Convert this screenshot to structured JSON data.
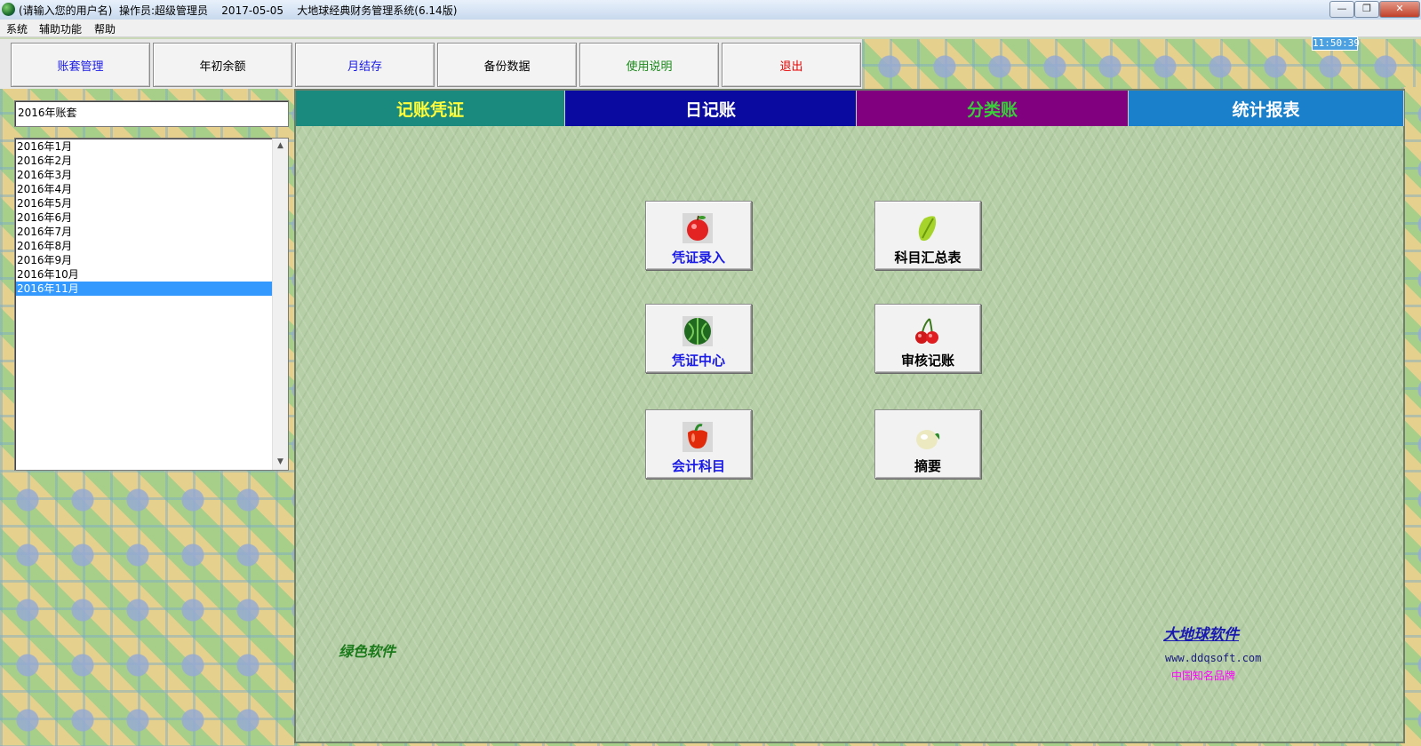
{
  "window": {
    "title": "(请输入您的用户名)  操作员:超级管理员    2017-05-05    大地球经典财务管理系统(6.14版)",
    "min_glyph": "—",
    "max_glyph": "❐",
    "close_glyph": "✕"
  },
  "menu": [
    "系统",
    "辅助功能",
    "帮助"
  ],
  "clock": "11:50:39",
  "toolbar": [
    {
      "label": "账套管理",
      "color": "#1a1ae6"
    },
    {
      "label": "年初余额",
      "color": "#000000"
    },
    {
      "label": "月结存",
      "color": "#1a1ae6"
    },
    {
      "label": "备份数据",
      "color": "#000000"
    },
    {
      "label": "使用说明",
      "color": "#1a8a1a"
    },
    {
      "label": "退出",
      "color": "#e60000"
    }
  ],
  "account_set": "2016年账套",
  "periods": [
    "2016年1月",
    "2016年2月",
    "2016年3月",
    "2016年4月",
    "2016年5月",
    "2016年6月",
    "2016年7月",
    "2016年8月",
    "2016年9月",
    "2016年10月",
    "2016年11月"
  ],
  "selected_period": "2016年11月",
  "tabs": [
    {
      "label": "记账凭证",
      "bg": "#1a8a7f",
      "fg": "#ffff3a"
    },
    {
      "label": "日记账",
      "bg": "#0a0aa0",
      "fg": "#ffffff"
    },
    {
      "label": "分类账",
      "bg": "#800080",
      "fg": "#3acc3a"
    },
    {
      "label": "统计报表",
      "bg": "#1a80cc",
      "fg": "#ffffff"
    }
  ],
  "functions": [
    {
      "label": "凭证录入",
      "icon": "apple-icon",
      "color": "#1a1ae6"
    },
    {
      "label": "凭证中心",
      "icon": "watermelon-icon",
      "color": "#1a1ae6"
    },
    {
      "label": "会计科目",
      "icon": "pepper-icon",
      "color": "#1a1ae6"
    },
    {
      "label": "科目汇总表",
      "icon": "starfruit-icon",
      "color": "#000000"
    },
    {
      "label": "审核记账",
      "icon": "cherry-icon",
      "color": "#000000"
    },
    {
      "label": "摘要",
      "icon": "melon-icon",
      "color": "#000000"
    }
  ],
  "branding": {
    "green_software": "绿色软件",
    "company": "大地球软件",
    "url": "www.ddqsoft.com",
    "slogan": "中国知名品牌"
  }
}
